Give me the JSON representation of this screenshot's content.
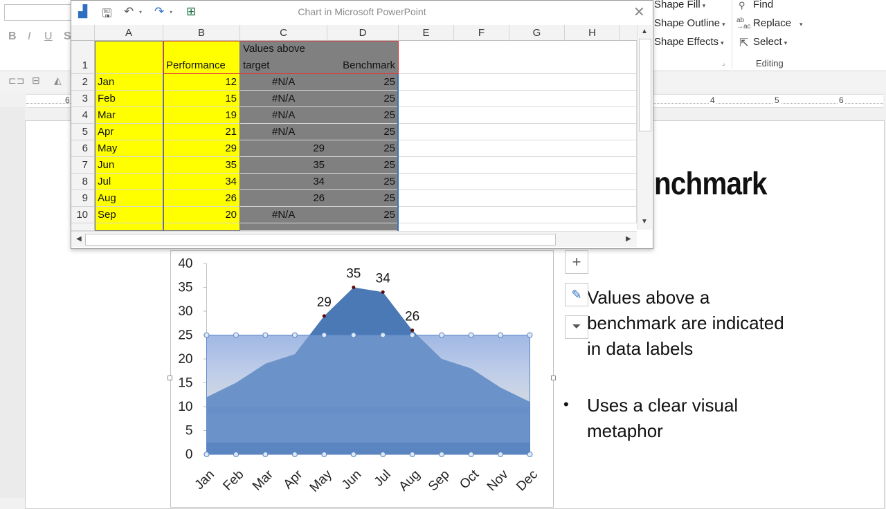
{
  "ribbon": {
    "drawing_items": [
      {
        "label": "Shape Fill",
        "caret": "▾"
      },
      {
        "label": "Shape Outline",
        "caret": "▾"
      },
      {
        "label": "Shape Effects",
        "caret": "▾"
      }
    ],
    "editing_items": [
      {
        "label": "Find",
        "caret": ""
      },
      {
        "label": "Replace",
        "caret": "▾"
      },
      {
        "label": "Select",
        "caret": "▾"
      }
    ],
    "editing_group_label": "Editing",
    "font_buttons": [
      "B",
      "I",
      "U",
      "S"
    ]
  },
  "ruler": {
    "numbers": [
      "6",
      "4",
      "5",
      "6"
    ]
  },
  "slide": {
    "title_fragment": "nchmark",
    "bullets": [
      "Values above a benchmark  are indicated in data labels",
      "Uses a clear visual metaphor"
    ],
    "bullet_char": "•"
  },
  "excel": {
    "title": "Chart in Microsoft PowerPoint",
    "close": "✕",
    "columns": [
      "A",
      "B",
      "C",
      "D",
      "E",
      "F",
      "G",
      "H"
    ],
    "header_row": {
      "row": "1",
      "b": "Performance",
      "c_line1": "Values above",
      "c_line2": "target",
      "d": "Benchmark"
    },
    "rows": [
      {
        "row": "2",
        "month": "Jan",
        "perf": "12",
        "above": "#N/A",
        "bench": "25"
      },
      {
        "row": "3",
        "month": "Feb",
        "perf": "15",
        "above": "#N/A",
        "bench": "25"
      },
      {
        "row": "4",
        "month": "Mar",
        "perf": "19",
        "above": "#N/A",
        "bench": "25"
      },
      {
        "row": "5",
        "month": "Apr",
        "perf": "21",
        "above": "#N/A",
        "bench": "25"
      },
      {
        "row": "6",
        "month": "May",
        "perf": "29",
        "above": "29",
        "bench": "25"
      },
      {
        "row": "7",
        "month": "Jun",
        "perf": "35",
        "above": "35",
        "bench": "25"
      },
      {
        "row": "8",
        "month": "Jul",
        "perf": "34",
        "above": "34",
        "bench": "25"
      },
      {
        "row": "9",
        "month": "Aug",
        "perf": "26",
        "above": "26",
        "bench": "25"
      },
      {
        "row": "10",
        "month": "Sep",
        "perf": "20",
        "above": "#N/A",
        "bench": "25"
      }
    ],
    "colors": {
      "yellow": "#ffff00",
      "gray": "#808080",
      "grid": "#d8d8d8"
    }
  },
  "chart_data": {
    "type": "area",
    "categories": [
      "Jan",
      "Feb",
      "Mar",
      "Apr",
      "May",
      "Jun",
      "Jul",
      "Aug",
      "Sep",
      "Oct",
      "Nov",
      "Dec"
    ],
    "series": [
      {
        "values": [
          12,
          15,
          19,
          21,
          29,
          35,
          34,
          26,
          20,
          18,
          14,
          11
        ],
        "color": "#4a79b5"
      },
      {
        "values": [
          25,
          25,
          25,
          25,
          25,
          25,
          25,
          25,
          25,
          25,
          25,
          25
        ],
        "color": "#9fb5dd"
      }
    ],
    "data_labels": [
      {
        "category": "May",
        "value": "29"
      },
      {
        "category": "Jun",
        "value": "35"
      },
      {
        "category": "Jul",
        "value": "34"
      },
      {
        "category": "Aug",
        "value": "26"
      }
    ],
    "yticks": [
      "0",
      "5",
      "10",
      "15",
      "20",
      "25",
      "30",
      "35",
      "40"
    ],
    "ylim": [
      0,
      40
    ],
    "title": "",
    "xlabel": "",
    "ylabel": "",
    "grid": false
  },
  "chart_buttons": [
    "+",
    "✎",
    "⏷"
  ]
}
